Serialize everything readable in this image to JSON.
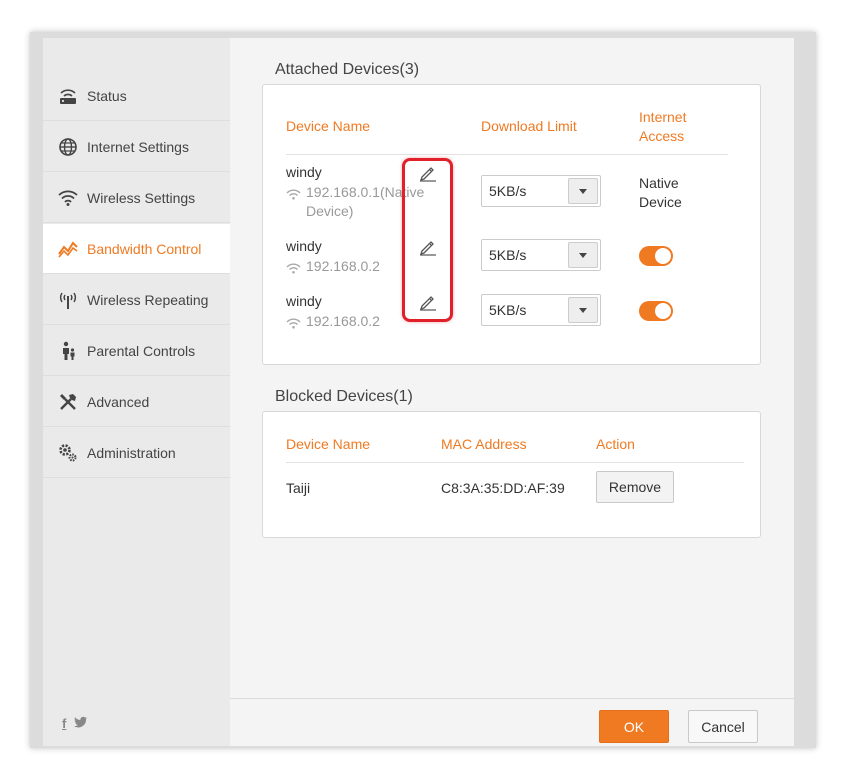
{
  "sidebar": {
    "items": [
      {
        "label": "Status",
        "icon": "router-icon"
      },
      {
        "label": "Internet Settings",
        "icon": "globe-icon"
      },
      {
        "label": "Wireless Settings",
        "icon": "wifi-icon"
      },
      {
        "label": "Bandwidth Control",
        "icon": "bandwidth-chart-icon",
        "active": true
      },
      {
        "label": "Wireless Repeating",
        "icon": "antenna-icon"
      },
      {
        "label": "Parental Controls",
        "icon": "family-icon"
      },
      {
        "label": "Advanced",
        "icon": "tools-icon"
      },
      {
        "label": "Administration",
        "icon": "gears-icon"
      }
    ],
    "social": {
      "facebook": "f",
      "twitter": "twitter-icon"
    }
  },
  "attached": {
    "title": "Attached Devices(3)",
    "headers": {
      "device_name": "Device Name",
      "download_limit": "Download Limit",
      "internet_access": "Internet Access"
    },
    "devices": [
      {
        "name": "windy",
        "ip": "192.168.0.1(Native Device)",
        "limit": "5KB/s",
        "access": "Native Device"
      },
      {
        "name": "windy",
        "ip": "192.168.0.2",
        "limit": "5KB/s",
        "access_enabled": true
      },
      {
        "name": "windy",
        "ip": "192.168.0.2",
        "limit": "5KB/s",
        "access_enabled": true
      }
    ]
  },
  "blocked": {
    "title": "Blocked Devices(1)",
    "headers": {
      "device_name": "Device Name",
      "mac_address": "MAC Address",
      "action": "Action"
    },
    "devices": [
      {
        "name": "Taiji",
        "mac": "C8:3A:35:DD:AF:39",
        "action_label": "Remove"
      }
    ]
  },
  "footer": {
    "ok_label": "OK",
    "cancel_label": "Cancel"
  },
  "colors": {
    "accent": "#f07a22",
    "highlight": "#e0202a"
  }
}
